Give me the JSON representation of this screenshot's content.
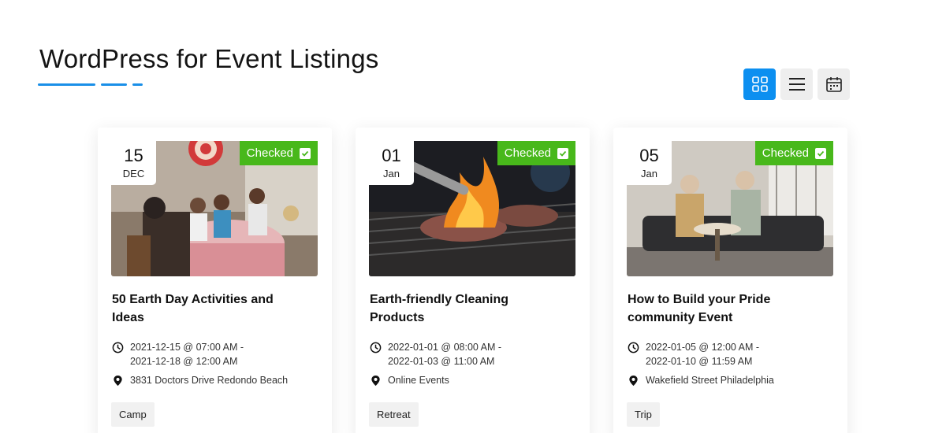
{
  "page": {
    "title": "WordPress for Event Listings"
  },
  "view_switch": {
    "options": [
      {
        "name": "grid",
        "icon": "grid-icon",
        "active": true
      },
      {
        "name": "list",
        "icon": "list-icon",
        "active": false
      },
      {
        "name": "calendar",
        "icon": "calendar-icon",
        "active": false
      }
    ]
  },
  "colors": {
    "accent": "#0c8ff0",
    "checked": "#48b81b"
  },
  "events": [
    {
      "day": "15",
      "month": "DEC",
      "badge": "Checked",
      "title": "50 Earth Day Activities and Ideas",
      "time_start": "2021-12-15 @ 07:00 AM -",
      "time_end": "2021-12-18 @ 12:00 AM",
      "location": "3831 Doctors Drive Redondo Beach",
      "tag": "Camp",
      "image": "family-dinner-party-photo"
    },
    {
      "day": "01",
      "month": "Jan",
      "badge": "Checked",
      "title": "Earth-friendly Cleaning Products",
      "time_start": "2022-01-01 @ 08:00 AM -",
      "time_end": "2022-01-03 @ 11:00 AM",
      "location": "Online Events",
      "tag": "Retreat",
      "image": "barbecue-grill-fire-photo"
    },
    {
      "day": "05",
      "month": "Jan",
      "badge": "Checked",
      "title": "How to Build your Pride community Event",
      "time_start": "2022-01-05 @ 12:00 AM -",
      "time_end": "2022-01-10 @ 11:59 AM",
      "location": "Wakefield Street Philadelphia",
      "tag": "Trip",
      "image": "seniors-living-room-photo"
    }
  ]
}
